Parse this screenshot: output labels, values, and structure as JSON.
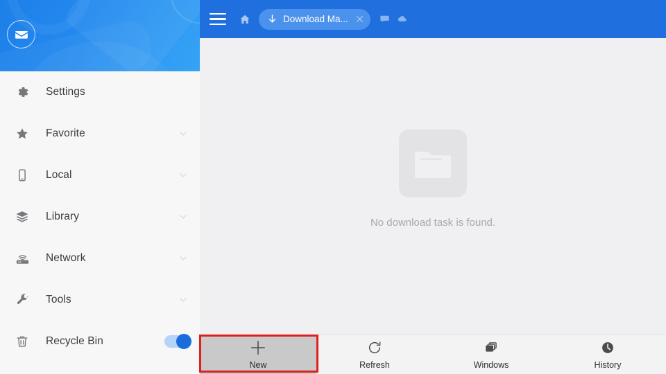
{
  "sidebar": {
    "avatar_icon": "envelope-icon",
    "items": [
      {
        "label": "Settings",
        "icon": "gear-icon",
        "accessory": "none"
      },
      {
        "label": "Favorite",
        "icon": "star-icon",
        "accessory": "chevron-down"
      },
      {
        "label": "Local",
        "icon": "phone-icon",
        "accessory": "chevron-down"
      },
      {
        "label": "Library",
        "icon": "layers-icon",
        "accessory": "chevron-down"
      },
      {
        "label": "Network",
        "icon": "router-icon",
        "accessory": "chevron-down"
      },
      {
        "label": "Tools",
        "icon": "wrench-icon",
        "accessory": "chevron-down"
      },
      {
        "label": "Recycle Bin",
        "icon": "trash-icon",
        "accessory": "toggle",
        "toggle_on": true
      }
    ]
  },
  "topbar": {
    "menu_icon": "hamburger-icon",
    "home_icon": "home-icon",
    "tab": {
      "icon": "download-arrow-icon",
      "title": "Download Ma...",
      "close_icon": "close-icon"
    },
    "chat_icon": "chat-icon",
    "cloud_icon": "cloud-icon"
  },
  "content": {
    "empty_icon": "folder-icon",
    "empty_message": "No download task is found."
  },
  "toolbar": {
    "buttons": [
      {
        "label": "New",
        "icon": "plus-icon",
        "active": true
      },
      {
        "label": "Refresh",
        "icon": "refresh-icon",
        "active": false
      },
      {
        "label": "Windows",
        "icon": "windows-icon",
        "active": false
      },
      {
        "label": "History",
        "icon": "clock-icon",
        "active": false
      }
    ]
  },
  "annotation": {
    "highlight_color": "#e02020",
    "target": "New"
  },
  "colors": {
    "topbar_blue": "#1f6fdf",
    "header_gradient_start": "#1d7fe8",
    "header_gradient_end": "#36a4f5",
    "toggle_on": "#1b6ddd",
    "sidebar_bg": "#f7f7f8",
    "content_bg": "#f0f0f2"
  }
}
